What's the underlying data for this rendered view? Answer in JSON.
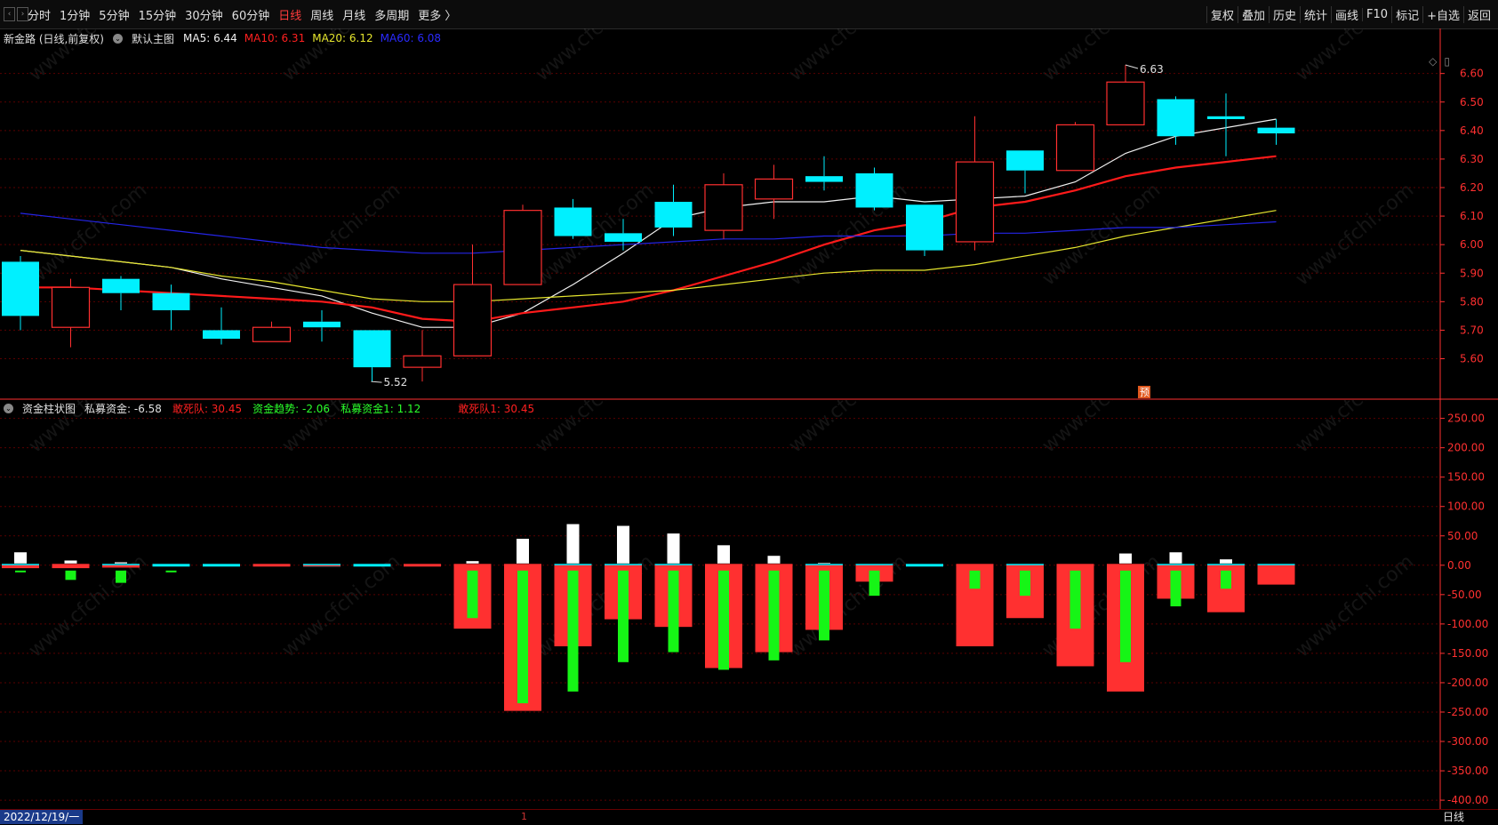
{
  "toolbar": {
    "nav_back": "‹",
    "nav_forward": "›",
    "periods": [
      {
        "label": "分时",
        "active": false
      },
      {
        "label": "1分钟",
        "active": false
      },
      {
        "label": "5分钟",
        "active": false
      },
      {
        "label": "15分钟",
        "active": false
      },
      {
        "label": "30分钟",
        "active": false
      },
      {
        "label": "60分钟",
        "active": false
      },
      {
        "label": "日线",
        "active": true
      },
      {
        "label": "周线",
        "active": false
      },
      {
        "label": "月线",
        "active": false
      },
      {
        "label": "多周期",
        "active": false
      },
      {
        "label": "更多 〉",
        "active": false
      }
    ],
    "tools": [
      "复权",
      "叠加",
      "历史",
      "统计",
      "画线",
      "F10",
      "标记",
      "+自选",
      "返回"
    ]
  },
  "price_legend": {
    "stock": "新金路 (日线,前复权)",
    "template": "默认主图",
    "ma": [
      {
        "text": "MA5: 6.44",
        "color": "#f0f0f0"
      },
      {
        "text": "MA10: 6.31",
        "color": "#ff2020"
      },
      {
        "text": "MA20: 6.12",
        "color": "#e6e62e"
      },
      {
        "text": "MA60: 6.08",
        "color": "#2a2aff"
      }
    ]
  },
  "indicator_legend": {
    "name": "资金柱状图",
    "items": [
      {
        "text": "私募资金: -6.58",
        "color": "#e0e0e0"
      },
      {
        "text": "敢死队: 30.45",
        "color": "#ff2020"
      },
      {
        "text": "资金趋势: -2.06",
        "color": "#2aff2a"
      },
      {
        "text": "私募资金1: 1.12",
        "color": "#2aff2a"
      },
      {
        "text": "敢死队1: 30.45",
        "color": "#ff2020"
      }
    ]
  },
  "colors": {
    "up": "#ff3030",
    "down": "#00f0ff",
    "ma5": "#f0f0f0",
    "ma10": "#ff1a1a",
    "ma20": "#e6e62e",
    "ma60": "#2424e6",
    "grid": "#5a0000",
    "axis": "#ff3030",
    "green": "#16f516",
    "white": "#ffffff"
  },
  "chart_data": [
    {
      "type": "candlestick",
      "title": "新金路 (日线,前复权)",
      "y_ticks": [
        "6.60",
        "6.50",
        "6.40",
        "6.30",
        "6.20",
        "6.10",
        "6.00",
        "5.90",
        "5.80",
        "5.70",
        "5.60"
      ],
      "ylim": [
        5.48,
        6.68
      ],
      "annotations": {
        "high": "6.63",
        "low": "5.52",
        "forecast_badge": "预"
      },
      "candles": [
        {
          "open": 5.94,
          "close": 5.75,
          "high": 5.96,
          "low": 5.7
        },
        {
          "open": 5.71,
          "close": 5.85,
          "high": 5.88,
          "low": 5.64
        },
        {
          "open": 5.88,
          "close": 5.83,
          "high": 5.89,
          "low": 5.77
        },
        {
          "open": 5.83,
          "close": 5.77,
          "high": 5.86,
          "low": 5.7
        },
        {
          "open": 5.7,
          "close": 5.67,
          "high": 5.78,
          "low": 5.65
        },
        {
          "open": 5.66,
          "close": 5.71,
          "high": 5.73,
          "low": 5.66
        },
        {
          "open": 5.73,
          "close": 5.71,
          "high": 5.77,
          "low": 5.66
        },
        {
          "open": 5.7,
          "close": 5.57,
          "high": 5.7,
          "low": 5.52
        },
        {
          "open": 5.57,
          "close": 5.61,
          "high": 5.7,
          "low": 5.52
        },
        {
          "open": 5.61,
          "close": 5.86,
          "high": 6.0,
          "low": 5.61
        },
        {
          "open": 5.86,
          "close": 6.12,
          "high": 6.14,
          "low": 5.86
        },
        {
          "open": 6.13,
          "close": 6.03,
          "high": 6.16,
          "low": 6.02
        },
        {
          "open": 6.04,
          "close": 6.01,
          "high": 6.09,
          "low": 5.98
        },
        {
          "open": 6.15,
          "close": 6.06,
          "high": 6.21,
          "low": 6.03
        },
        {
          "open": 6.05,
          "close": 6.21,
          "high": 6.25,
          "low": 6.02
        },
        {
          "open": 6.16,
          "close": 6.23,
          "high": 6.28,
          "low": 6.09
        },
        {
          "open": 6.24,
          "close": 6.22,
          "high": 6.31,
          "low": 6.19
        },
        {
          "open": 6.25,
          "close": 6.13,
          "high": 6.27,
          "low": 6.12
        },
        {
          "open": 6.14,
          "close": 5.98,
          "high": 6.14,
          "low": 5.96
        },
        {
          "open": 6.01,
          "close": 6.29,
          "high": 6.45,
          "low": 5.98
        },
        {
          "open": 6.33,
          "close": 6.26,
          "high": 6.33,
          "low": 6.18
        },
        {
          "open": 6.26,
          "close": 6.42,
          "high": 6.43,
          "low": 6.26
        },
        {
          "open": 6.42,
          "close": 6.57,
          "high": 6.63,
          "low": 6.42
        },
        {
          "open": 6.51,
          "close": 6.38,
          "high": 6.52,
          "low": 6.35
        },
        {
          "open": 6.45,
          "close": 6.44,
          "high": 6.53,
          "low": 6.31
        },
        {
          "open": 6.41,
          "close": 6.39,
          "high": 6.44,
          "low": 6.35
        }
      ],
      "series": [
        {
          "name": "MA5",
          "values": [
            5.98,
            5.96,
            5.94,
            5.92,
            5.88,
            5.85,
            5.82,
            5.76,
            5.71,
            5.71,
            5.76,
            5.86,
            5.97,
            6.09,
            6.13,
            6.15,
            6.15,
            6.17,
            6.15,
            6.16,
            6.17,
            6.22,
            6.32,
            6.38,
            6.41,
            6.44
          ]
        },
        {
          "name": "MA10",
          "values": [
            5.85,
            5.85,
            5.84,
            5.83,
            5.82,
            5.81,
            5.8,
            5.78,
            5.74,
            5.73,
            5.76,
            5.78,
            5.8,
            5.84,
            5.89,
            5.94,
            6.0,
            6.05,
            6.08,
            6.13,
            6.15,
            6.19,
            6.24,
            6.27,
            6.29,
            6.31
          ]
        },
        {
          "name": "MA20",
          "values": [
            5.98,
            5.96,
            5.94,
            5.92,
            5.89,
            5.87,
            5.84,
            5.81,
            5.8,
            5.8,
            5.81,
            5.82,
            5.83,
            5.84,
            5.86,
            5.88,
            5.9,
            5.91,
            5.91,
            5.93,
            5.96,
            5.99,
            6.03,
            6.06,
            6.09,
            6.12
          ]
        },
        {
          "name": "MA60",
          "values": [
            6.11,
            6.09,
            6.07,
            6.05,
            6.03,
            6.01,
            5.99,
            5.98,
            5.97,
            5.97,
            5.98,
            5.99,
            6.0,
            6.01,
            6.02,
            6.02,
            6.03,
            6.03,
            6.03,
            6.04,
            6.04,
            6.05,
            6.06,
            6.06,
            6.07,
            6.08
          ]
        }
      ]
    },
    {
      "type": "bar",
      "title": "资金柱状图",
      "y_ticks": [
        "250.00",
        "200.00",
        "150.00",
        "100.00",
        "50.00",
        "0.00",
        "-50.00",
        "-100.00",
        "-150.00",
        "-200.00",
        "-250.00",
        "-300.00",
        "-350.00",
        "-400.00"
      ],
      "ylim": [
        -415,
        260
      ],
      "series": [
        {
          "name": "私募资金",
          "values": [
            -5,
            -5,
            -4,
            0,
            0,
            0,
            -2,
            0,
            0,
            -108,
            -248,
            -138,
            -92,
            -105,
            -175,
            -148,
            -110,
            -28,
            0,
            -138,
            -90,
            -172,
            -215,
            -57,
            -80,
            -33
          ]
        },
        {
          "name": "资金趋势",
          "values": [
            -10,
            -25,
            -30,
            -5,
            0,
            0,
            0,
            0,
            0,
            -90,
            -235,
            -215,
            -165,
            -148,
            -178,
            -162,
            -128,
            -52,
            0,
            -40,
            -52,
            -108,
            -165,
            -70,
            -40,
            0
          ]
        },
        {
          "name": "敢死队",
          "values": [
            22,
            8,
            5,
            2,
            0,
            0,
            0,
            0,
            0,
            7,
            45,
            70,
            67,
            54,
            34,
            16,
            4,
            1,
            0,
            0,
            0,
            0,
            20,
            22,
            10,
            0
          ]
        },
        {
          "name": "私募资金1",
          "values": [
            1,
            1,
            1,
            1,
            1,
            1,
            1,
            1,
            1,
            1,
            1,
            1,
            1,
            1,
            1,
            1,
            1,
            1,
            1,
            1,
            1,
            1,
            1,
            1,
            1,
            1
          ]
        }
      ]
    }
  ],
  "status": {
    "date": "2022/12/19/一",
    "cursor": "1",
    "period": "日线"
  }
}
